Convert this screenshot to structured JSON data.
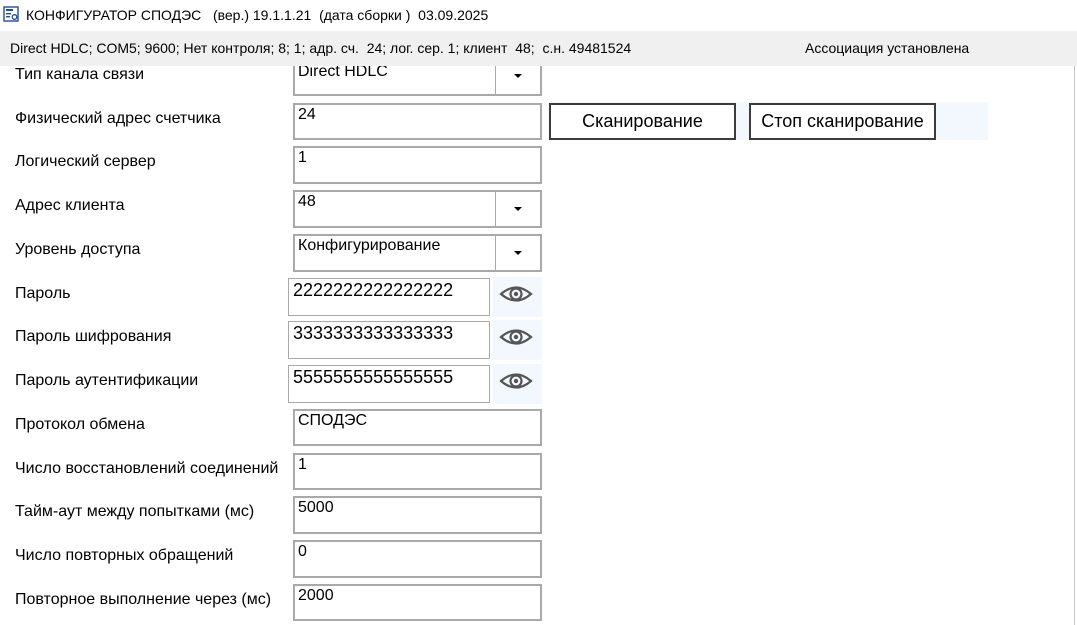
{
  "window": {
    "title": "КОНФИГУРАТОР СПОДЭС   (вер.) 19.1.1.21  (дата сборки )  03.09.2025",
    "icon": "app-config-icon"
  },
  "status": {
    "connection": "Direct HDLC; COM5; 9600; Нет контроля; 8; 1; адр. сч.  24; лог. сер. 1; клиент  48;  с.н. 49481524",
    "association": "Ассоциация установлена"
  },
  "form": {
    "channel_type": {
      "label": "Тип канала связи",
      "value": "Direct HDLC"
    },
    "phys_address": {
      "label": "Физический адрес счетчика",
      "value": "24"
    },
    "logical_server": {
      "label": "Логический сервер",
      "value": "1"
    },
    "client_address": {
      "label": "Адрес клиента",
      "value": "48"
    },
    "access_level": {
      "label": "Уровень доступа",
      "value": "Конфигурирование"
    },
    "password": {
      "label": "Пароль",
      "value": "2222222222222222"
    },
    "enc_password": {
      "label": "Пароль шифрования",
      "value": "3333333333333333"
    },
    "auth_password": {
      "label": "Пароль аутентификации",
      "value": "5555555555555555"
    },
    "protocol": {
      "label": "Протокол обмена",
      "value": "СПОДЭС"
    },
    "reconnects": {
      "label": "Число восстановлений соединений",
      "value": "1"
    },
    "timeout": {
      "label": "Тайм-аут между попытками (мс)",
      "value": "5000"
    },
    "repeat_requests": {
      "label": "Число повторных обращений",
      "value": "0"
    },
    "repeat_delay": {
      "label": "Повторное выполнение через (мс)",
      "value": "2000"
    }
  },
  "buttons": {
    "scan": "Сканирование",
    "stop_scan": "Стоп сканирование"
  },
  "colors": {
    "statusbar_bg": "#f0f0f0",
    "field_border": "#a9a9a9",
    "button_border": "#3c3c3c",
    "highlight_bg": "#f3f8fe"
  }
}
